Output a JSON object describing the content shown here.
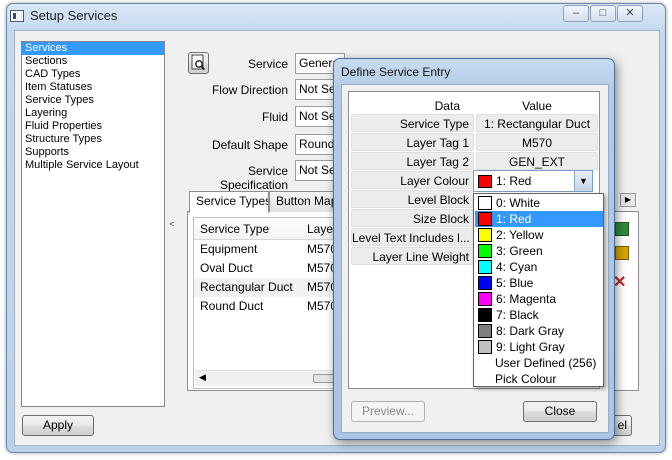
{
  "window": {
    "title": "Setup Services",
    "controls": [
      "–",
      "□",
      "✕"
    ]
  },
  "sidebar": {
    "items": [
      "Services",
      "Sections",
      "CAD Types",
      "Item Statuses",
      "Service Types",
      "Layering",
      "Fluid Properties",
      "Structure Types",
      "Supports",
      "Multiple Service Layout"
    ],
    "selected_index": 0
  },
  "splitter_glyph": "<",
  "form": {
    "service_label": "Service",
    "service_value": "Genera",
    "flow_direction_label": "Flow Direction",
    "flow_direction_value": "Not Set",
    "fluid_label": "Fluid",
    "fluid_value": "Not Set",
    "default_shape_label": "Default Shape",
    "default_shape_value": "Round",
    "service_specification_label": "Service Specification",
    "service_specification_value": "Not Se"
  },
  "tabs": [
    "Service Types",
    "Button Mapp"
  ],
  "service_types_table": {
    "columns": [
      "Service Type",
      "Layer"
    ],
    "rows": [
      [
        "Equipment",
        "M570"
      ],
      [
        "Oval Duct",
        "M570"
      ],
      [
        "Rectangular Duct",
        "M570"
      ],
      [
        "Round Duct",
        "M570"
      ]
    ]
  },
  "buttons": {
    "apply": "Apply",
    "cancel_partial": "el"
  },
  "dialog": {
    "title": "Define Service Entry",
    "header": {
      "key": "Data",
      "value": "Value"
    },
    "rows": [
      {
        "key": "Service Type",
        "value": "1: Rectangular Duct"
      },
      {
        "key": "Layer Tag 1",
        "value": "M570"
      },
      {
        "key": "Layer Tag 2",
        "value": "GEN_EXT"
      },
      {
        "key": "Layer Colour",
        "value": ""
      },
      {
        "key": "Level Block",
        "value": ""
      },
      {
        "key": "Size Block",
        "value": ""
      },
      {
        "key": "Level Text Includes l...",
        "value": ""
      },
      {
        "key": "Layer Line Weight",
        "value": ""
      }
    ],
    "colour_combo": {
      "value": "1: Red",
      "color": "#ff0000"
    },
    "colour_options": [
      {
        "label": "0: White",
        "color": "#ffffff"
      },
      {
        "label": "1: Red",
        "color": "#ff0000"
      },
      {
        "label": "2: Yellow",
        "color": "#ffff00"
      },
      {
        "label": "3: Green",
        "color": "#00ff00"
      },
      {
        "label": "4: Cyan",
        "color": "#00ffff"
      },
      {
        "label": "5: Blue",
        "color": "#0000ff"
      },
      {
        "label": "6: Magenta",
        "color": "#ff00ff"
      },
      {
        "label": "7: Black",
        "color": "#000000"
      },
      {
        "label": "8: Dark Gray",
        "color": "#808080"
      },
      {
        "label": "9: Light Gray",
        "color": "#c0c0c0"
      },
      {
        "label": "User Defined (256)",
        "color": ""
      },
      {
        "label": "Pick Colour",
        "color": ""
      }
    ],
    "selected_option_index": 1,
    "preview_button": "Preview...",
    "close_button": "Close"
  },
  "colors": {
    "selection": "#3399ff",
    "title_bar": "#c4d8ee"
  }
}
